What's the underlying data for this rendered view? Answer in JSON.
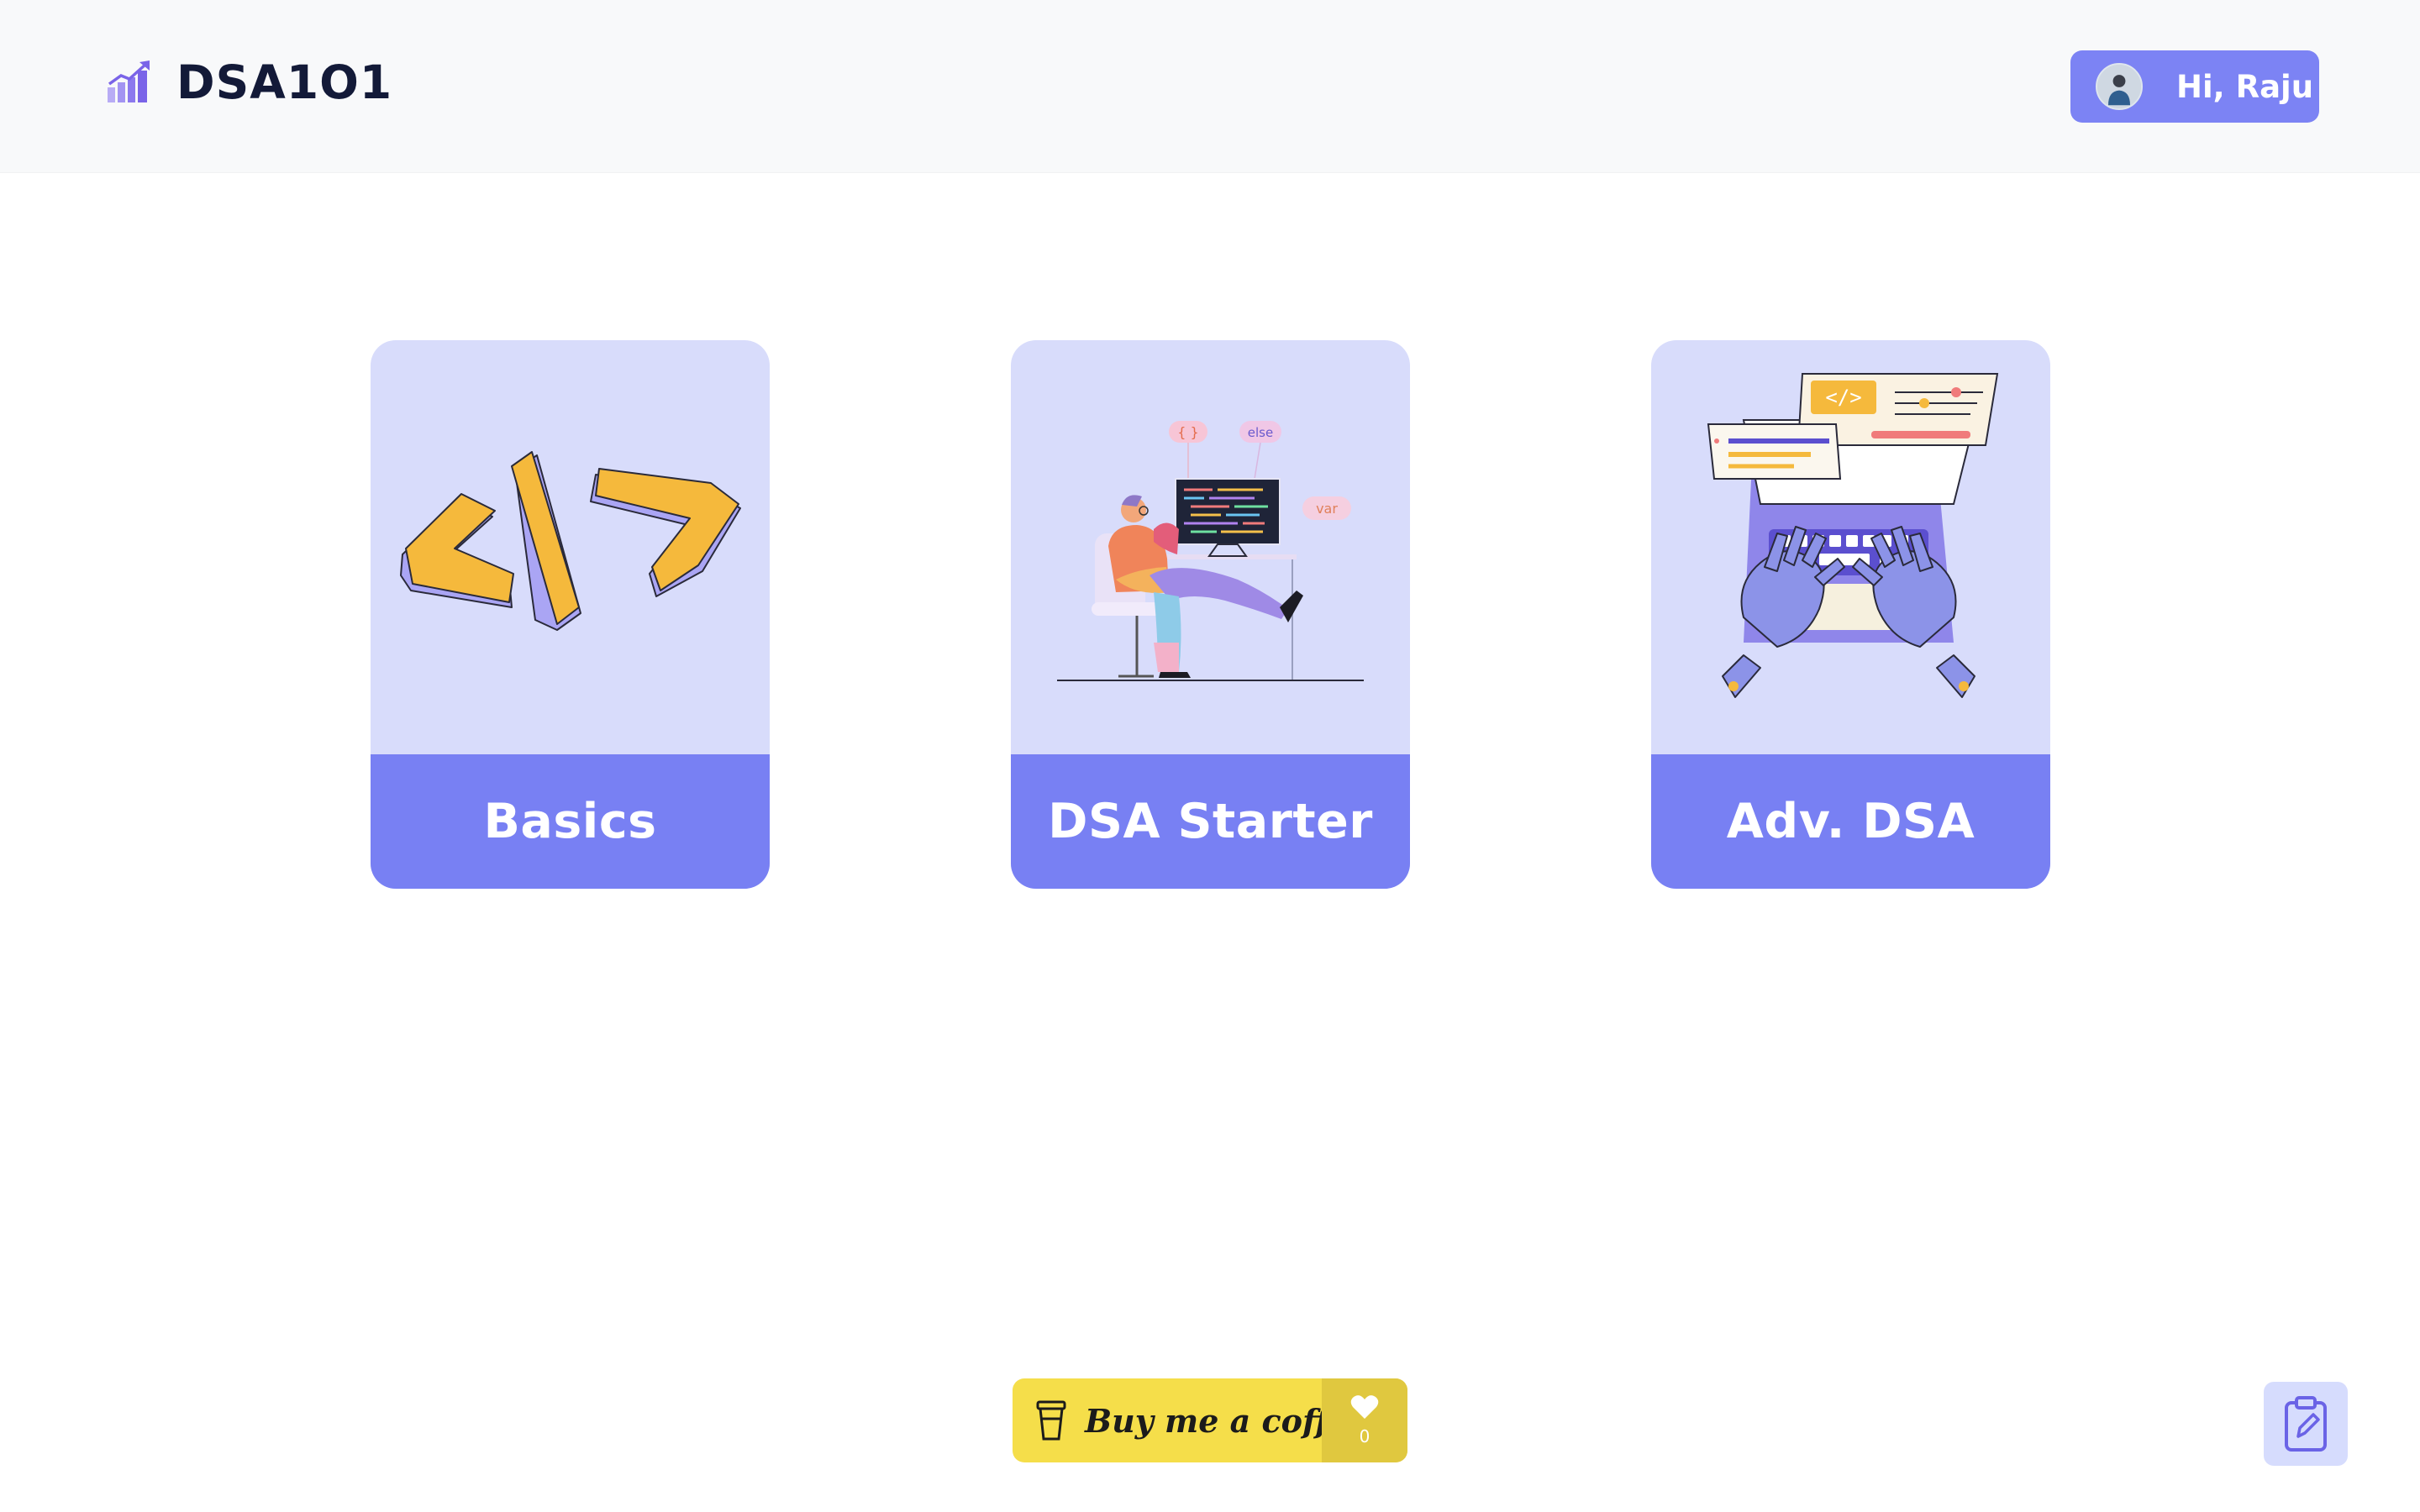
{
  "header": {
    "brand_name": "DSA1O1",
    "brand_icon": "chart-growth-icon",
    "user_greeting": "Hi, Raju",
    "avatar_icon": "user-avatar"
  },
  "cards": [
    {
      "title": "Basics",
      "illustration": "code-brackets-icon"
    },
    {
      "title": "DSA Starter",
      "illustration": "developer-at-desk-illustration",
      "tags": [
        "{ }",
        "else",
        "var"
      ]
    },
    {
      "title": "Adv. DSA",
      "illustration": "robot-hands-typing-illustration"
    }
  ],
  "footer": {
    "coffee_label": "Buy me a coffee",
    "coffee_icon": "coffee-cup-icon",
    "like_icon": "heart-icon",
    "like_count": "0",
    "notes_icon": "clipboard-edit-icon"
  },
  "colors": {
    "accent": "#7880f3",
    "card_bg": "#d8dcfb",
    "header_bg": "#f8f9fa",
    "coffee_bg": "#f5de4a",
    "coffee_like_bg": "#e0c83f",
    "notes_bg": "#d6dcfd"
  }
}
